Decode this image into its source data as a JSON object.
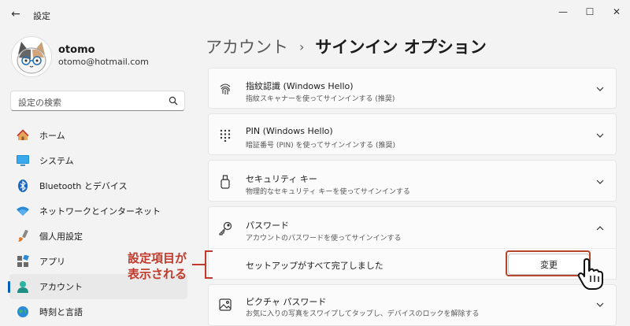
{
  "window": {
    "title": "設定",
    "back_glyph": "←",
    "minimize_glyph": "—",
    "maximize_glyph": "☐",
    "close_glyph": "✕"
  },
  "user": {
    "name": "otomo",
    "email": "otomo@hotmail.com"
  },
  "search": {
    "placeholder": "設定の検索"
  },
  "nav": {
    "items": [
      {
        "label": "ホーム",
        "icon": "home-icon"
      },
      {
        "label": "システム",
        "icon": "system-icon"
      },
      {
        "label": "Bluetooth とデバイス",
        "icon": "bluetooth-icon"
      },
      {
        "label": "ネットワークとインターネット",
        "icon": "wifi-icon"
      },
      {
        "label": "個人用設定",
        "icon": "brush-icon"
      },
      {
        "label": "アプリ",
        "icon": "apps-icon"
      },
      {
        "label": "アカウント",
        "icon": "account-icon",
        "active": true
      },
      {
        "label": "時刻と言語",
        "icon": "globe-icon"
      }
    ]
  },
  "breadcrumb": {
    "parent": "アカウント",
    "separator": "›",
    "current": "サインイン オプション"
  },
  "cards": [
    {
      "title": "指紋認識 (Windows Hello)",
      "subtitle": "指紋スキャナーを使ってサインインする (推奨)",
      "icon": "fingerprint-icon",
      "expanded": false
    },
    {
      "title": "PIN (Windows Hello)",
      "subtitle": "暗証番号 (PIN) を使ってサインインする (推奨)",
      "icon": "pin-keypad-icon",
      "expanded": false
    },
    {
      "title": "セキュリティ キー",
      "subtitle": "物理的なセキュリティ キーを使ってサインインする",
      "icon": "security-key-icon",
      "expanded": false
    },
    {
      "title": "パスワード",
      "subtitle": "アカウントのパスワードを使ってサインインする",
      "icon": "key-icon",
      "expanded": true
    },
    {
      "title": "ピクチャ パスワード",
      "subtitle": "お気に入りの写真をスワイプしてタップし、デバイスのロックを解除する",
      "icon": "picture-icon",
      "expanded": false
    }
  ],
  "password_expanded": {
    "status": "セットアップがすべて完了しました",
    "button_label": "変更"
  },
  "annotation": {
    "line1": "設定項目が",
    "line2": "表示される"
  },
  "colors": {
    "accent": "#005fb8",
    "annotation_red": "#c0392b"
  }
}
